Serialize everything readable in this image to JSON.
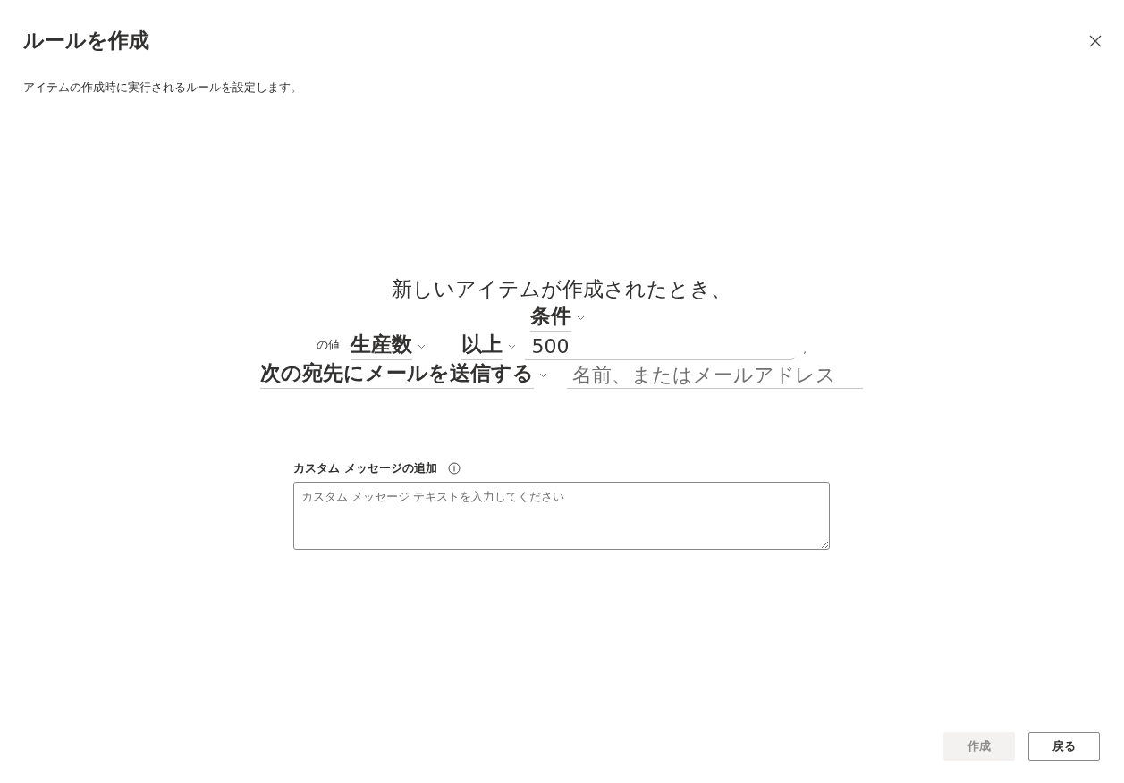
{
  "dialog": {
    "title": "ルールを作成",
    "description": "アイテムの作成時に実行されるルールを設定します。"
  },
  "rule": {
    "trigger": "新しいアイテムが作成されたとき、",
    "condition": {
      "label": "条件"
    },
    "value_prefix": "の値",
    "column": {
      "label": "生産数"
    },
    "operator": {
      "label": "以上"
    },
    "value": "500",
    "separator": ",",
    "action": {
      "label": "次の宛先にメールを送信する"
    },
    "recipient": {
      "placeholder": "名前、またはメールアドレス"
    }
  },
  "custom_message": {
    "label": "カスタム メッセージの追加",
    "placeholder": "カスタム メッセージ テキストを入力してください"
  },
  "buttons": [
    {
      "label": "作成",
      "disabled": true
    },
    {
      "label": "戻る",
      "disabled": false
    }
  ]
}
